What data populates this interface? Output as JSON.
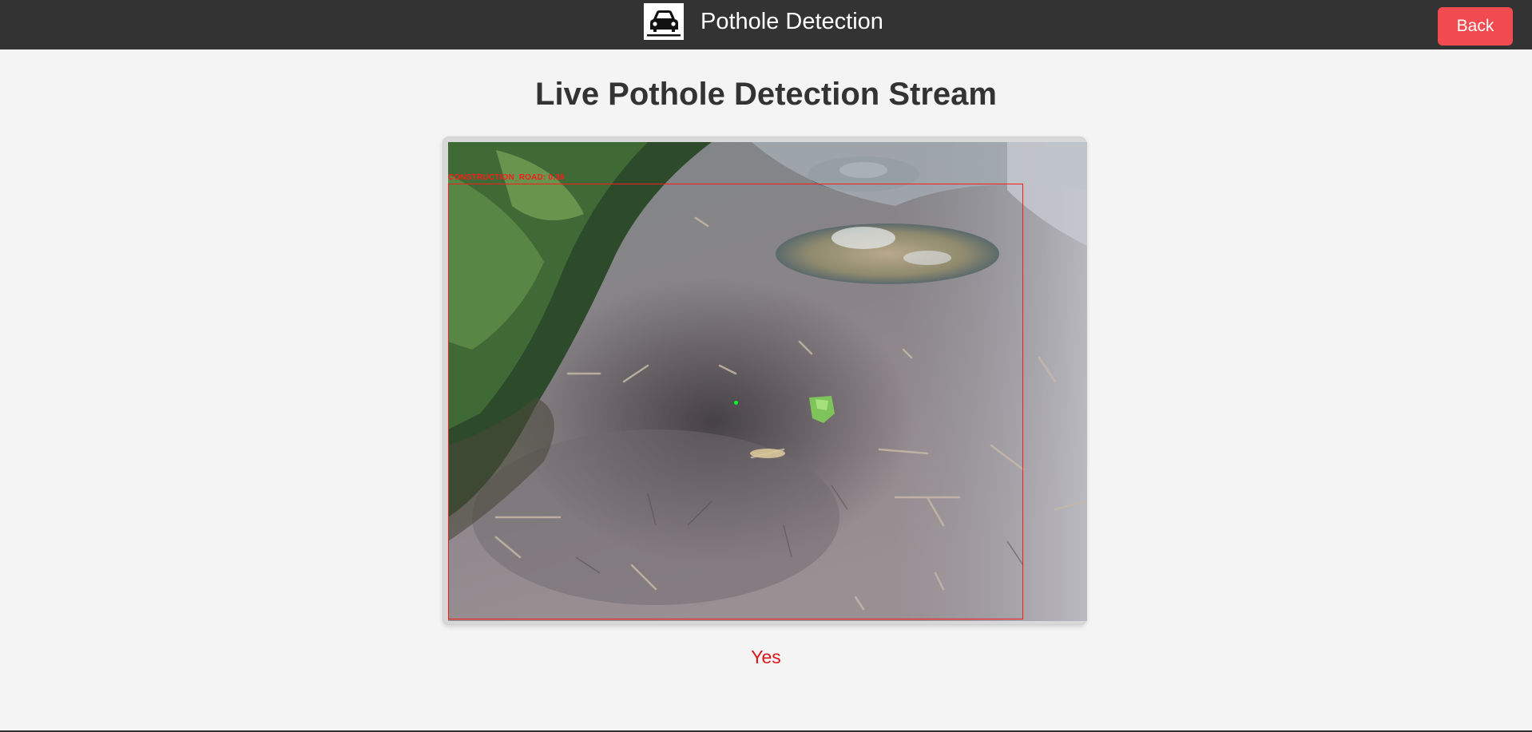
{
  "app": {
    "title": "Pothole Detection",
    "logo_icon": "car-icon"
  },
  "nav": {
    "back_label": "Back"
  },
  "main": {
    "heading": "Live Pothole Detection Stream",
    "stream": {
      "detection_label": "CONSTRUCTION_ROAD: 0.36",
      "box_color": "#ff1a1a",
      "center_marker_color": "#00ff22"
    },
    "status": {
      "text": "Yes",
      "color": "#e0151a"
    }
  },
  "colors": {
    "header_bg": "#333333",
    "back_button_bg": "#f24b4f",
    "page_bg": "#f4f4f4"
  }
}
